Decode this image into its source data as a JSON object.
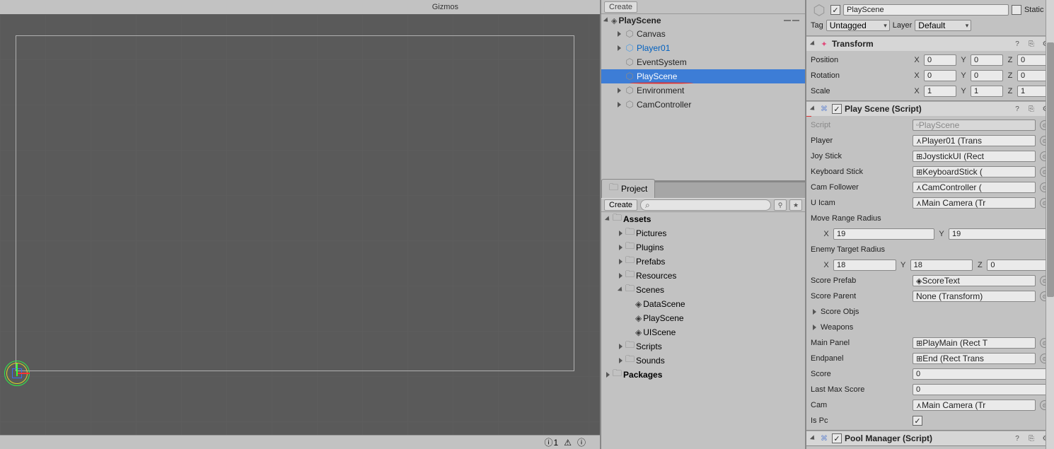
{
  "scene_toolbar": {
    "gizmos": "Gizmos"
  },
  "hierarchy": {
    "create": "Create",
    "scene": "PlayScene",
    "items": [
      {
        "label": "Canvas",
        "expandable": true
      },
      {
        "label": "Player01",
        "prefab": true,
        "expandable": true
      },
      {
        "label": "EventSystem"
      },
      {
        "label": "PlayScene",
        "selected": true
      },
      {
        "label": "Environment",
        "expandable": true
      },
      {
        "label": "CamController",
        "expandable": true
      }
    ]
  },
  "project": {
    "tab": "Project",
    "create": "Create",
    "assets": "Assets",
    "folders": [
      "Pictures",
      "Plugins",
      "Prefabs",
      "Resources"
    ],
    "scenes_folder": "Scenes",
    "scenes": [
      "DataScene",
      "PlayScene",
      "UIScene"
    ],
    "folders2": [
      "Scripts",
      "Sounds"
    ],
    "packages": "Packages"
  },
  "inspector": {
    "name": "PlayScene",
    "static": "Static",
    "tag_label": "Tag",
    "tag_value": "Untagged",
    "layer_label": "Layer",
    "layer_value": "Default",
    "transform": {
      "title": "Transform",
      "position": "Position",
      "rotation": "Rotation",
      "scale": "Scale",
      "px": "0",
      "py": "0",
      "pz": "0",
      "rx": "0",
      "ry": "0",
      "rz": "0",
      "sx": "1",
      "sy": "1",
      "sz": "1"
    },
    "playscene": {
      "title": "Play Scene (Script)",
      "script_label": "Script",
      "script_value": "PlayScene",
      "player_label": "Player",
      "player_value": "Player01 (Trans",
      "joystick_label": "Joy Stick",
      "joystick_value": "JoystickUI (Rect",
      "keyboard_label": "Keyboard Stick",
      "keyboard_value": "KeyboardStick (",
      "camfollower_label": "Cam Follower",
      "camfollower_value": "CamController (",
      "uicam_label": "U Icam",
      "uicam_value": "Main Camera (Tr",
      "moverange_label": "Move Range Radius",
      "moverange_x": "19",
      "moverange_y": "19",
      "enemytarget_label": "Enemy Target Radius",
      "enemytarget_x": "18",
      "enemytarget_y": "18",
      "enemytarget_z": "0",
      "scoreprefab_label": "Score Prefab",
      "scoreprefab_value": "ScoreText",
      "scoreparent_label": "Score Parent",
      "scoreparent_value": "None (Transform)",
      "scoreobjs_label": "Score Objs",
      "weapons_label": "Weapons",
      "mainpanel_label": "Main Panel",
      "mainpanel_value": "PlayMain (Rect T",
      "endpanel_label": "Endpanel",
      "endpanel_value": "End (Rect Trans",
      "score_label": "Score",
      "score_value": "0",
      "lastmax_label": "Last Max Score",
      "lastmax_value": "0",
      "cam_label": "Cam",
      "cam_value": "Main Camera (Tr",
      "ispc_label": "Is Pc"
    },
    "poolmanager": {
      "title": "Pool Manager (Script)"
    }
  },
  "status": {
    "error_count": "1"
  }
}
